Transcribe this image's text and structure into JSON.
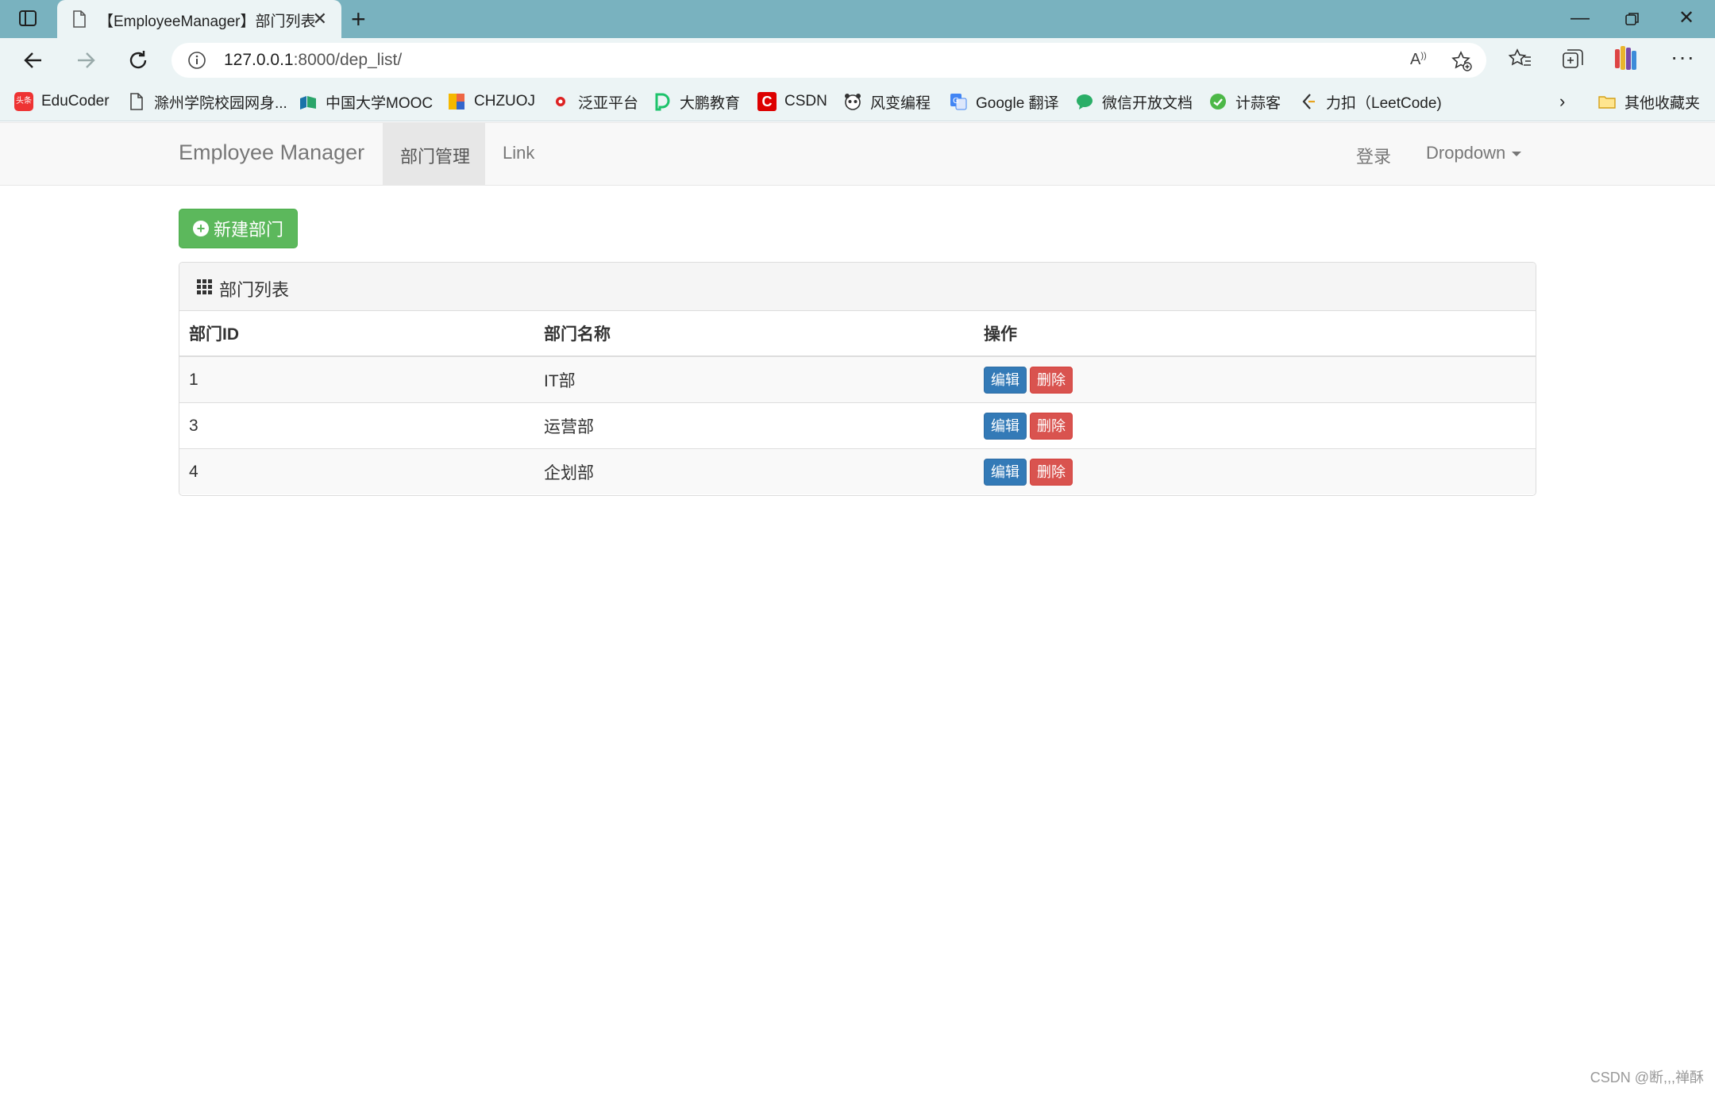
{
  "browser": {
    "tab_title": "【EmployeeManager】部门列表",
    "url_host": "127.0.0.1",
    "url_path": ":8000/dep_list/",
    "bookmarks": [
      {
        "label": "EduCoder",
        "icon": "toutiao-icon",
        "color": "#e33"
      },
      {
        "label": "滁州学院校园网身...",
        "icon": "page-icon",
        "color": "#555"
      },
      {
        "label": "中国大学MOOC",
        "icon": "mooc-icon",
        "color": "#1a73a8"
      },
      {
        "label": "CHZUOJ",
        "icon": "chzuoj-icon",
        "color": "#f5b800"
      },
      {
        "label": "泛亚平台",
        "icon": "fanya-icon",
        "color": "#d22"
      },
      {
        "label": "大鹏教育",
        "icon": "dapeng-icon",
        "color": "#1dc36b"
      },
      {
        "label": "CSDN",
        "icon": "csdn-icon",
        "color": "#d00"
      },
      {
        "label": "风变编程",
        "icon": "panda-icon",
        "color": "#333"
      },
      {
        "label": "Google 翻译",
        "icon": "google-translate-icon",
        "color": "#4285f4"
      },
      {
        "label": "微信开放文档",
        "icon": "wechat-icon",
        "color": "#2aae67"
      },
      {
        "label": "计蒜客",
        "icon": "jisuanke-icon",
        "color": "#4cb847"
      },
      {
        "label": "力扣（LeetCode)",
        "icon": "leetcode-icon",
        "color": "#e7a41f"
      }
    ],
    "other_bookmarks": "其他收藏夹"
  },
  "navbar": {
    "brand": "Employee Manager",
    "active_item": "部门管理",
    "link": "Link",
    "login": "登录",
    "dropdown": "Dropdown"
  },
  "actions": {
    "new_department": "新建部门"
  },
  "panel": {
    "title": "部门列表",
    "headers": [
      "部门ID",
      "部门名称",
      "操作"
    ],
    "rows": [
      {
        "id": "1",
        "name": "IT部"
      },
      {
        "id": "3",
        "name": "运营部"
      },
      {
        "id": "4",
        "name": "企划部"
      }
    ],
    "edit_label": "编辑",
    "delete_label": "删除"
  },
  "watermark": "CSDN @断,,,禅酥",
  "colors": {
    "success": "#5cb85c",
    "primary": "#337ab7",
    "danger": "#d9534f",
    "browser_frame": "#79b2bf"
  }
}
